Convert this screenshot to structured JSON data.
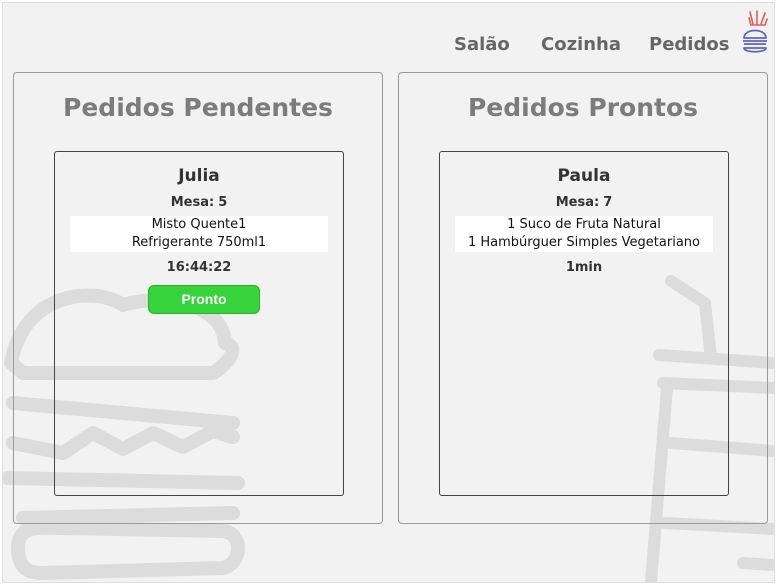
{
  "nav": {
    "salao": "Salão",
    "cozinha": "Cozinha",
    "pedidos": "Pedidos"
  },
  "logo": {
    "icon": "burger-fries-icon",
    "colors": {
      "burger": "#5a67c5",
      "fries": "#e05b5b"
    }
  },
  "pending": {
    "title": "Pedidos Pendentes",
    "order": {
      "customer": "Julia",
      "mesa_label": "Mesa:",
      "mesa": "5",
      "items": [
        "Misto Quente1",
        "Refrigerante 750ml1"
      ],
      "time": "16:44:22",
      "button": "Pronto"
    }
  },
  "ready": {
    "title": "Pedidos Prontos",
    "order": {
      "customer": "Paula",
      "mesa_label": "Mesa:",
      "mesa": "7",
      "items": [
        "1 Suco de Fruta Natural",
        "1 Hambúrguer Simples Vegetariano"
      ],
      "duration": "1min"
    }
  },
  "colors": {
    "accent_button": "#36d33b",
    "background": "#f2f2f2"
  }
}
